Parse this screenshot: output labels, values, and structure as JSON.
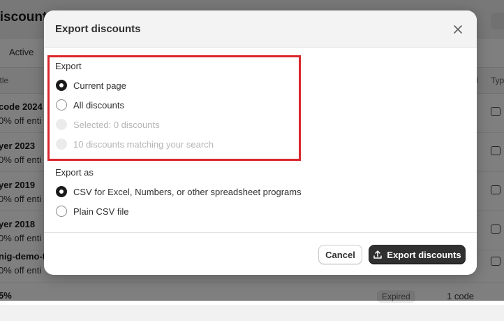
{
  "background": {
    "title": "Discounts",
    "tab_active": "Active",
    "col_title": "Title",
    "col_type": "Typ",
    "col_d": "d",
    "rows": [
      {
        "name": "code 2024",
        "desc": "0% off enti"
      },
      {
        "name": "yer 2023",
        "desc": "0% off enti"
      },
      {
        "name": "yer 2019",
        "desc": "0% off enti"
      },
      {
        "name": "yer 2018",
        "desc": "0% off enti"
      },
      {
        "name": "nig-demo-t",
        "desc": "0% off enti"
      }
    ],
    "last_row_name": "5%",
    "last_row_status": "Expired",
    "last_row_count": "1 code"
  },
  "modal": {
    "title": "Export discounts",
    "close_icon": "x-icon",
    "export_section": {
      "label": "Export",
      "options": [
        {
          "label": "Current page",
          "checked": true,
          "disabled": false
        },
        {
          "label": "All discounts",
          "checked": false,
          "disabled": false
        },
        {
          "label": "Selected: 0 discounts",
          "checked": false,
          "disabled": true
        },
        {
          "label": "10 discounts matching your search",
          "checked": false,
          "disabled": true
        }
      ]
    },
    "export_as_section": {
      "label": "Export as",
      "options": [
        {
          "label": "CSV for Excel, Numbers, or other spreadsheet programs",
          "checked": true,
          "disabled": false
        },
        {
          "label": "Plain CSV file",
          "checked": false,
          "disabled": false
        }
      ]
    },
    "footer": {
      "cancel_label": "Cancel",
      "export_label": "Export discounts",
      "export_icon": "upload-icon"
    }
  },
  "colors": {
    "highlight": "#d9262c",
    "primary_button": "#303030"
  }
}
